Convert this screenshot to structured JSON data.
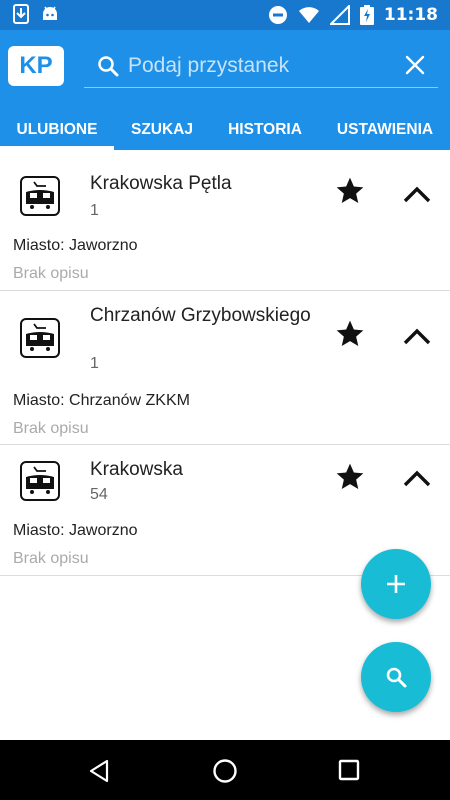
{
  "status_bar": {
    "time": "11:18"
  },
  "app": {
    "logo": "KP"
  },
  "search": {
    "placeholder": "Podaj przystanek"
  },
  "tabs": [
    {
      "label": "ULUBIONE",
      "active": true
    },
    {
      "label": "SZUKAJ",
      "active": false
    },
    {
      "label": "HISTORIA",
      "active": false
    },
    {
      "label": "USTAWIENIA",
      "active": false
    }
  ],
  "favorites": [
    {
      "name": "Krakowska Pętla",
      "number": "1",
      "city": "Miasto: Jaworzno",
      "description": "Brak opisu"
    },
    {
      "name": "Chrzanów Grzybowskiego",
      "number": "1",
      "city": "Miasto: Chrzanów ZKKM",
      "description": "Brak opisu"
    },
    {
      "name": "Krakowska",
      "number": "54",
      "city": "Miasto: Jaworzno",
      "description": "Brak opisu"
    }
  ],
  "colors": {
    "status_bar": "#1778cd",
    "app_bar": "#1e90e8",
    "fab": "#18bdd5"
  }
}
